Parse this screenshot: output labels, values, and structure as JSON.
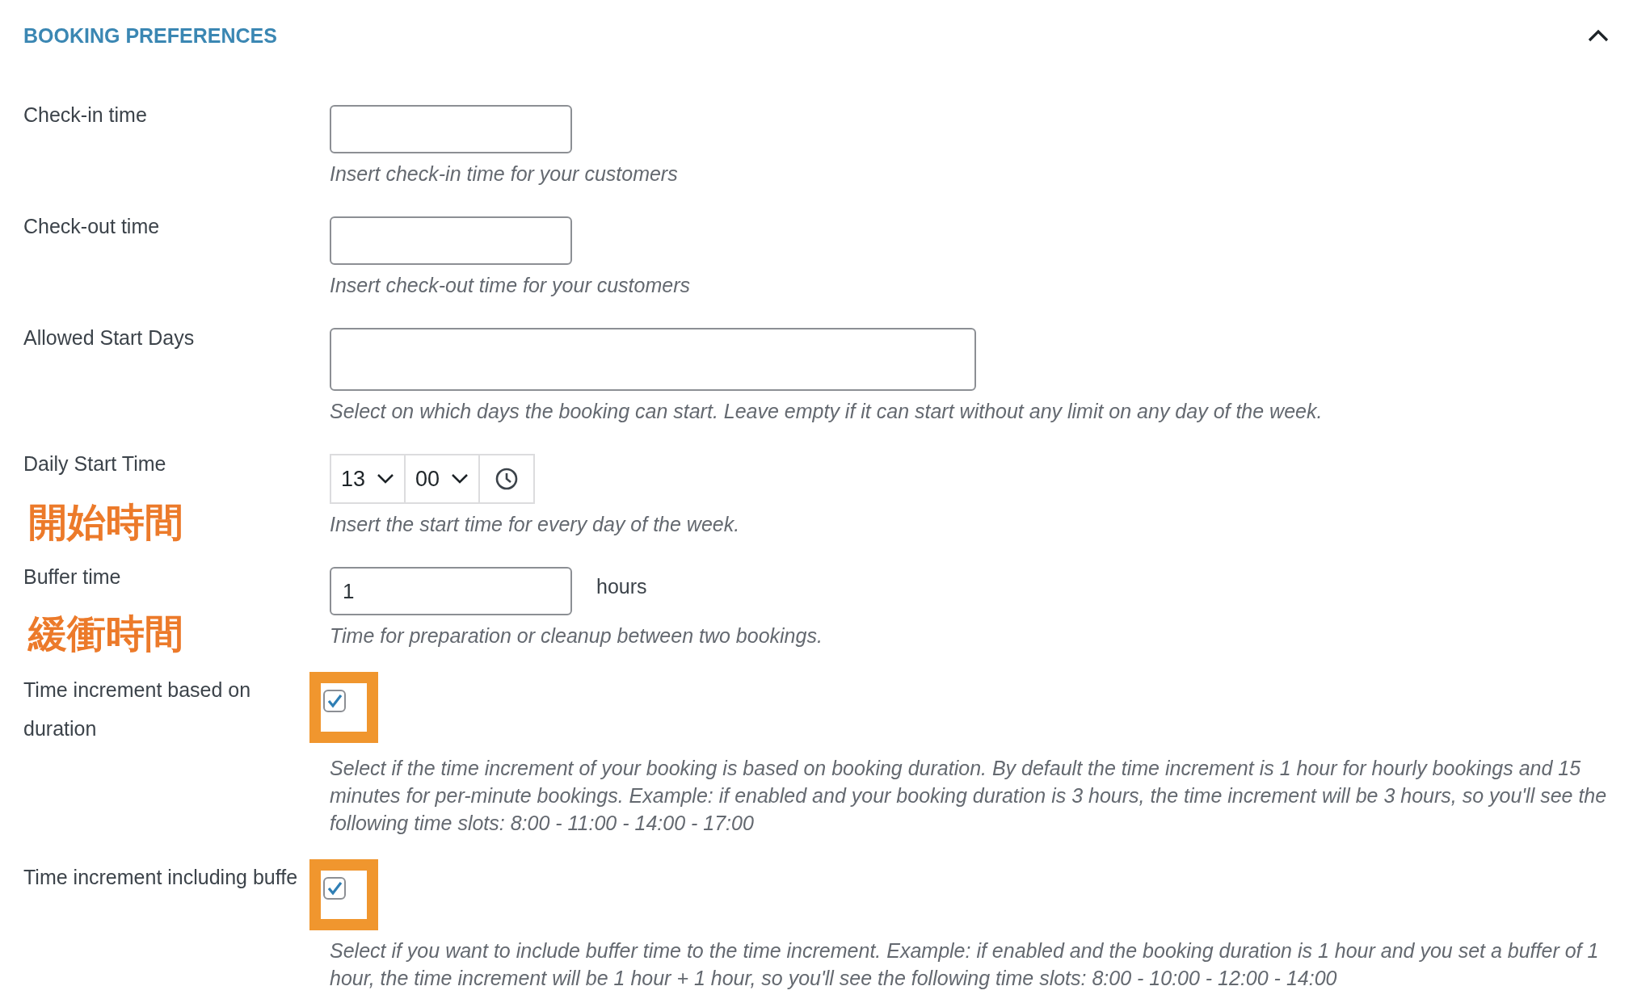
{
  "section": {
    "title": "BOOKING PREFERENCES",
    "expanded": true
  },
  "fields": [
    {
      "kind": "text",
      "label": "Check-in time",
      "description": "Insert check-in time for your customers"
    },
    {
      "kind": "text",
      "label": "Check-out time",
      "description": "Insert check-out time for your customers"
    },
    {
      "kind": "wide",
      "label": "Allowed Start Days",
      "description": "Select on which days the booking can start. Leave empty if it can start without any limit on any day of the week."
    },
    {
      "kind": "time",
      "label": "Daily Start Time",
      "annotation": "開始時間",
      "hour": "13",
      "minute": "00",
      "description": "Insert the start time for every day of the week."
    },
    {
      "kind": "number",
      "label": "Buffer time",
      "annotation": "緩衝時間",
      "value": "1",
      "unit": "hours",
      "description": "Time for preparation or cleanup between two bookings."
    },
    {
      "kind": "checkbox",
      "label": "Time increment based on duration",
      "checked": true,
      "highlighted": true,
      "description": "Select if the time increment of your booking is based on booking duration. By default the time increment is 1 hour for hourly bookings and 15 minutes for per-minute bookings. Example: if enabled and your booking duration is 3 hours, the time increment will be 3 hours, so you'll see the following time slots: 8:00 - 11:00 - 14:00 - 17:00"
    },
    {
      "kind": "checkbox",
      "label": "Time increment including buffe",
      "checked": true,
      "highlighted": true,
      "description": "Select if you want to include buffer time to the time increment. Example: if enabled and the booking duration is 1 hour and you set a buffer of 1 hour, the time increment will be 1 hour + 1 hour, so you'll see the following time slots: 8:00 - 10:00 - 12:00 - 14:00"
    }
  ]
}
